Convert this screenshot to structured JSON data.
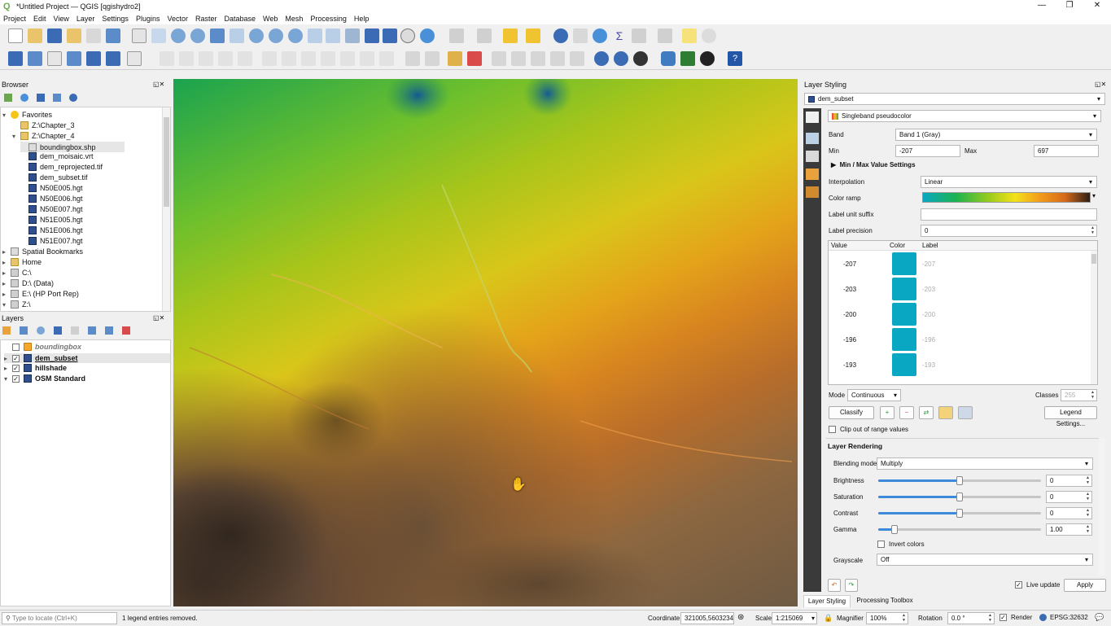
{
  "window": {
    "title": "*Untitled Project — QGIS [qgishydro2]",
    "minimize": "—",
    "maximize": "❐",
    "close": "✕"
  },
  "menu": [
    "Project",
    "Edit",
    "View",
    "Layer",
    "Settings",
    "Plugins",
    "Vector",
    "Raster",
    "Database",
    "Web",
    "Mesh",
    "Processing",
    "Help"
  ],
  "browser": {
    "title": "Browser",
    "items": [
      {
        "label": "Favorites"
      },
      {
        "label": "Z:\\Chapter_3"
      },
      {
        "label": "Z:\\Chapter_4"
      },
      {
        "label": "boundingbox.shp"
      },
      {
        "label": "dem_moisaic.vrt"
      },
      {
        "label": "dem_reprojected.tif"
      },
      {
        "label": "dem_subset.tif"
      },
      {
        "label": "N50E005.hgt"
      },
      {
        "label": "N50E006.hgt"
      },
      {
        "label": "N50E007.hgt"
      },
      {
        "label": "N51E005.hgt"
      },
      {
        "label": "N51E006.hgt"
      },
      {
        "label": "N51E007.hgt"
      },
      {
        "label": "Spatial Bookmarks"
      },
      {
        "label": "Home"
      },
      {
        "label": "C:\\"
      },
      {
        "label": "D:\\ (Data)"
      },
      {
        "label": "E:\\ (HP Port Rep)"
      },
      {
        "label": "Z:\\"
      }
    ]
  },
  "layers": {
    "title": "Layers",
    "items": [
      {
        "label": "boundingbox",
        "checked": false
      },
      {
        "label": "dem_subset",
        "checked": true
      },
      {
        "label": "hillshade",
        "checked": true
      },
      {
        "label": "OSM Standard",
        "checked": true
      }
    ]
  },
  "styling": {
    "title": "Layer Styling",
    "layer": "dem_subset",
    "renderer": "Singleband pseudocolor",
    "band_label": "Band",
    "band": "Band 1 (Gray)",
    "min_label": "Min",
    "min": "-207",
    "max_label": "Max",
    "max": "697",
    "minmax_settings": "Min / Max Value Settings",
    "interpolation_label": "Interpolation",
    "interpolation": "Linear",
    "color_ramp_label": "Color ramp",
    "label_unit_suffix_label": "Label unit suffix",
    "label_precision_label": "Label precision",
    "label_precision": "0",
    "table_headers": [
      "Value",
      "Color",
      "Label"
    ],
    "entries": [
      {
        "value": "-207",
        "label": "-207"
      },
      {
        "value": "-203",
        "label": "-203"
      },
      {
        "value": "-200",
        "label": "-200"
      },
      {
        "value": "-196",
        "label": "-196"
      },
      {
        "value": "-193",
        "label": "-193"
      }
    ],
    "entry_color": "#0aa7c2",
    "mode_label": "Mode",
    "mode": "Continuous",
    "classes_label": "Classes",
    "classes": "255",
    "classify": "Classify",
    "legend_settings": "Legend Settings...",
    "clip_label": "Clip out of range values",
    "layer_rendering": "Layer Rendering",
    "blending_label": "Blending mode",
    "blending": "Multiply",
    "brightness_label": "Brightness",
    "brightness": "0",
    "saturation_label": "Saturation",
    "saturation": "0",
    "contrast_label": "Contrast",
    "contrast": "0",
    "gamma_label": "Gamma",
    "gamma": "1.00",
    "invert_label": "Invert colors",
    "grayscale_label": "Grayscale",
    "grayscale": "Off",
    "live_update": "Live update",
    "apply": "Apply",
    "tab_styling": "Layer Styling",
    "tab_toolbox": "Processing Toolbox"
  },
  "status": {
    "locate_placeholder": "Type to locate (Ctrl+K)",
    "message": "1 legend entries removed.",
    "coordinate_label": "Coordinate",
    "coordinate": "321005,5603234",
    "scale_label": "Scale",
    "scale": "1:215069",
    "magnifier_label": "Magnifier",
    "magnifier": "100%",
    "rotation_label": "Rotation",
    "rotation": "0.0 °",
    "render_label": "Render",
    "crs": "EPSG:32632"
  }
}
